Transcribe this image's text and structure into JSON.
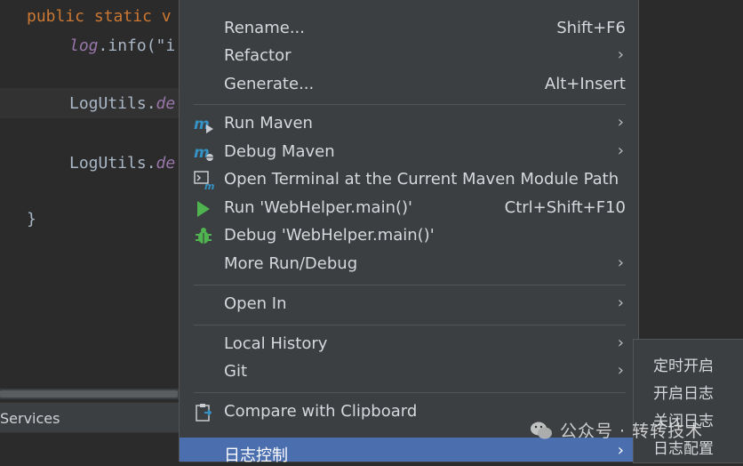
{
  "editor": {
    "lines": [
      {
        "kw": "public static ",
        "rest": "v"
      },
      {
        "ital": "log",
        "rest": ".info(\"i"
      },
      {
        "plain": "LogUtils.",
        "ital": "de"
      },
      {
        "plain": "LogUtils.",
        "ital": "de"
      },
      {
        "plain": "}"
      }
    ]
  },
  "bottom_panel": {
    "services_label": "Services"
  },
  "context_menu": {
    "items": [
      {
        "label": "Rename...",
        "shortcut": "Shift+F6"
      },
      {
        "label": "Refactor",
        "arrow": "›"
      },
      {
        "label": "Generate...",
        "shortcut": "Alt+Insert"
      },
      {
        "label": "Run Maven",
        "arrow": "›",
        "icon": "maven-run-icon"
      },
      {
        "label": "Debug Maven",
        "arrow": "›",
        "icon": "maven-debug-icon"
      },
      {
        "label": "Open Terminal at the Current Maven Module Path",
        "icon": "terminal-maven-icon"
      },
      {
        "label": "Run 'WebHelper.main()'",
        "shortcut": "Ctrl+Shift+F10",
        "icon": "run-icon"
      },
      {
        "label": "Debug 'WebHelper.main()'",
        "icon": "debug-bug-icon"
      },
      {
        "label": "More Run/Debug",
        "arrow": "›"
      },
      {
        "label": "Open In",
        "arrow": "›"
      },
      {
        "label": "Local History",
        "arrow": "›"
      },
      {
        "label": "Git",
        "arrow": "›"
      },
      {
        "label": "Compare with Clipboard",
        "icon": "compare-clipboard-icon"
      },
      {
        "label": "日志控制",
        "arrow": "›"
      }
    ]
  },
  "submenu": {
    "items": [
      "定时开启",
      "开启日志",
      "关闭日志",
      "日志配置"
    ]
  },
  "watermark": {
    "text": "公众号 · 转转技术"
  },
  "colors": {
    "menu_bg": "#3c3f41",
    "selected": "#4b6eaf",
    "editor_bg": "#2b2b2b"
  }
}
